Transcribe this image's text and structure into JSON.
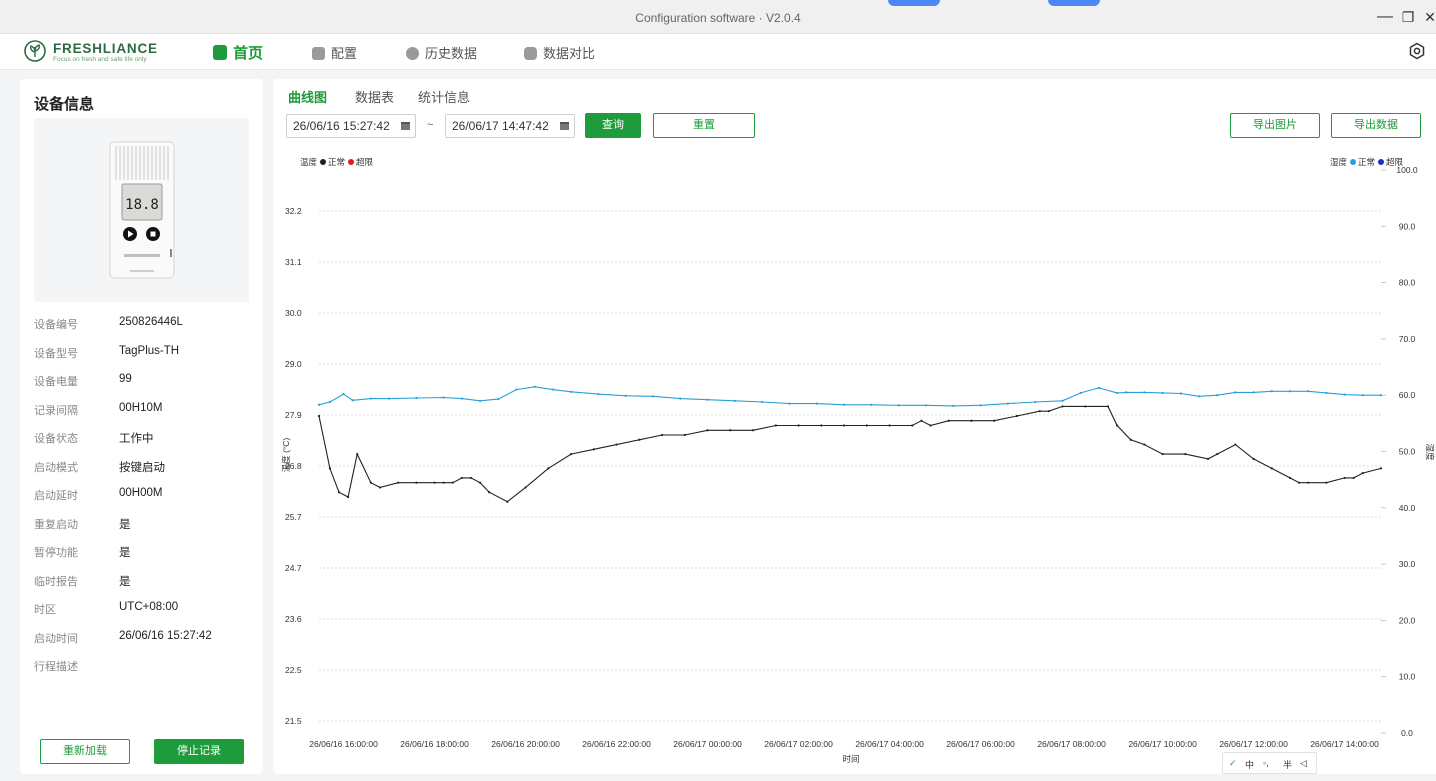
{
  "window": {
    "title": "Configuration software · V2.0.4",
    "minimize": "—",
    "restore": "❐",
    "close": "✕"
  },
  "brand": {
    "name": "FRESHLIANCE",
    "slogan": "Focus on fresh and safe life only"
  },
  "nav": {
    "items": [
      {
        "label": "首页",
        "icon": "home-icon",
        "active": true
      },
      {
        "label": "配置",
        "icon": "config-icon",
        "active": false
      },
      {
        "label": "历史数据",
        "icon": "clock-icon",
        "active": false
      },
      {
        "label": "数据对比",
        "icon": "compare-icon",
        "active": false
      }
    ]
  },
  "device": {
    "title": "设备信息",
    "screen_reading": "18.8",
    "fields": [
      {
        "key": "设备编号",
        "value": "250826446L"
      },
      {
        "key": "设备型号",
        "value": "TagPlus-TH"
      },
      {
        "key": "设备电量",
        "value": "99"
      },
      {
        "key": "记录间隔",
        "value": "00H10M"
      },
      {
        "key": "设备状态",
        "value": "工作中"
      },
      {
        "key": "启动模式",
        "value": "按键启动"
      },
      {
        "key": "启动延时",
        "value": "00H00M"
      },
      {
        "key": "重复启动",
        "value": "是"
      },
      {
        "key": "暂停功能",
        "value": "是"
      },
      {
        "key": "临时报告",
        "value": "是"
      },
      {
        "key": "时区",
        "value": "UTC+08:00"
      },
      {
        "key": "启动时间",
        "value": "26/06/16 15:27:42"
      },
      {
        "key": "行程描述",
        "value": ""
      }
    ],
    "reload_label": "重新加载",
    "stop_label": "停止记录"
  },
  "main": {
    "tabs": [
      {
        "label": "曲线图",
        "active": true
      },
      {
        "label": "数据表",
        "active": false
      },
      {
        "label": "统计信息",
        "active": false
      }
    ],
    "start_date": "26/06/16 15:27:42",
    "end_date": "26/06/17 14:47:42",
    "range_sep": "~",
    "query_label": "查询",
    "reset_label": "重置",
    "export_image_label": "导出图片",
    "export_data_label": "导出数据"
  },
  "legend": {
    "left": {
      "name": "温度",
      "normal": "正常",
      "over": "超限"
    },
    "right": {
      "name": "湿度",
      "normal": "正常",
      "over": "超限"
    }
  },
  "colors": {
    "accent": "#1e9b3a",
    "temp_normal": "#222222",
    "temp_over": "#e31b1b",
    "hum_normal": "#2a9fd6",
    "hum_over": "#1a2ec9"
  },
  "chart_data": {
    "type": "line",
    "xlabel": "时间",
    "ylabel": "温度 (°C)",
    "y2label": "湿度",
    "ylim": [
      21.5,
      32.2
    ],
    "y2lim": [
      0.0,
      100.0
    ],
    "yticks": [
      "32.2",
      "31.1",
      "30.0",
      "29.0",
      "27.9",
      "26.8",
      "25.7",
      "24.7",
      "23.6",
      "22.5",
      "21.5"
    ],
    "y2ticks": [
      "100.0",
      "90.0",
      "80.0",
      "70.0",
      "60.0",
      "50.0",
      "40.0",
      "30.0",
      "20.0",
      "10.0",
      "0.0"
    ],
    "xticks": [
      "26/06/16 16:00:00",
      "26/06/16 18:00:00",
      "26/06/16 20:00:00",
      "26/06/16 22:00:00",
      "26/06/17 00:00:00",
      "26/06/17 02:00:00",
      "26/06/17 04:00:00",
      "26/06/17 06:00:00",
      "26/06/17 08:00:00",
      "26/06/17 10:00:00",
      "26/06/17 12:00:00",
      "26/06/17 14:00:00"
    ],
    "xlim_hours": [
      15.46,
      38.8
    ],
    "grid": true,
    "series": [
      {
        "name": "温度",
        "axis": "left",
        "x_hours": [
          15.46,
          15.7,
          15.9,
          16.1,
          16.3,
          16.6,
          16.8,
          17.2,
          17.6,
          18.0,
          18.2,
          18.4,
          18.6,
          18.8,
          19.0,
          19.2,
          19.6,
          20.0,
          20.5,
          21.0,
          21.5,
          22.0,
          22.5,
          23.0,
          23.5,
          24.0,
          24.5,
          25.0,
          25.5,
          26.0,
          26.5,
          27.0,
          27.5,
          28.0,
          28.5,
          28.7,
          28.9,
          29.3,
          29.8,
          30.3,
          30.8,
          31.3,
          31.5,
          31.8,
          32.3,
          32.8,
          33.0,
          33.3,
          33.6,
          34.0,
          34.5,
          35.0,
          35.2,
          35.6,
          36.0,
          36.4,
          36.8,
          37.0,
          37.2,
          37.6,
          38.0,
          38.2,
          38.4,
          38.8
        ],
        "values": [
          27.9,
          26.8,
          26.3,
          26.2,
          27.1,
          26.5,
          26.4,
          26.5,
          26.5,
          26.5,
          26.5,
          26.5,
          26.6,
          26.6,
          26.5,
          26.3,
          26.1,
          26.4,
          26.8,
          27.1,
          27.2,
          27.3,
          27.4,
          27.5,
          27.5,
          27.6,
          27.6,
          27.6,
          27.7,
          27.7,
          27.7,
          27.7,
          27.7,
          27.7,
          27.7,
          27.8,
          27.7,
          27.8,
          27.8,
          27.8,
          27.9,
          28.0,
          28.0,
          28.1,
          28.1,
          28.1,
          27.7,
          27.4,
          27.3,
          27.1,
          27.1,
          27.0,
          27.1,
          27.3,
          27.0,
          26.8,
          26.6,
          26.5,
          26.5,
          26.5,
          26.6,
          26.6,
          26.7,
          26.8
        ]
      },
      {
        "name": "湿度",
        "axis": "right",
        "x_hours": [
          15.46,
          15.7,
          16.0,
          16.2,
          16.6,
          17.0,
          17.6,
          18.2,
          18.6,
          19.0,
          19.4,
          19.8,
          20.2,
          20.6,
          21.0,
          21.6,
          22.2,
          22.8,
          23.4,
          24.0,
          24.6,
          25.2,
          25.8,
          26.4,
          27.0,
          27.6,
          28.2,
          28.8,
          29.4,
          30.0,
          30.6,
          31.2,
          31.8,
          32.2,
          32.6,
          33.0,
          33.2,
          33.6,
          34.0,
          34.4,
          34.8,
          35.2,
          35.6,
          36.0,
          36.4,
          36.8,
          37.2,
          37.6,
          38.0,
          38.4,
          38.8
        ],
        "values": [
          58.3,
          58.8,
          60.2,
          59.1,
          59.4,
          59.4,
          59.5,
          59.6,
          59.4,
          59.0,
          59.3,
          61.0,
          61.5,
          61.0,
          60.6,
          60.2,
          59.9,
          59.8,
          59.4,
          59.2,
          59.0,
          58.8,
          58.5,
          58.5,
          58.3,
          58.3,
          58.2,
          58.2,
          58.1,
          58.2,
          58.5,
          58.8,
          59.0,
          60.4,
          61.3,
          60.4,
          60.5,
          60.5,
          60.4,
          60.3,
          59.8,
          60.0,
          60.5,
          60.5,
          60.7,
          60.7,
          60.7,
          60.4,
          60.1,
          60.0,
          60.0
        ]
      }
    ]
  },
  "ime": {
    "mode": "中",
    "punct": "◦,",
    "width": "半"
  }
}
